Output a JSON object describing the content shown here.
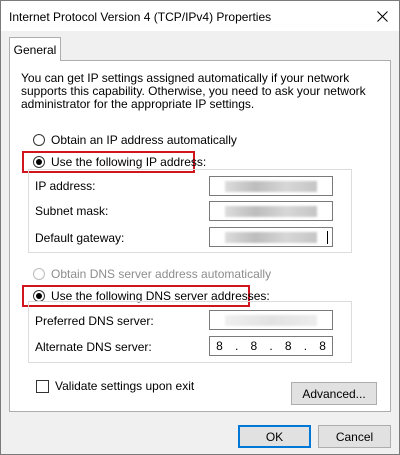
{
  "window": {
    "title": "Internet Protocol Version 4 (TCP/IPv4) Properties"
  },
  "tab": {
    "label": "General"
  },
  "description": "You can get IP settings assigned automatically if your network supports this capability. Otherwise, you need to ask your network administrator for the appropriate IP settings.",
  "ip_mode": {
    "auto_label": "Obtain an IP address automatically",
    "manual_label": "Use the following IP address:",
    "selected": "manual"
  },
  "ip_fields": {
    "ip_address_label": "IP address:",
    "subnet_mask_label": "Subnet mask:",
    "default_gateway_label": "Default gateway:"
  },
  "dns_mode": {
    "auto_label": "Obtain DNS server address automatically",
    "manual_label": "Use the following DNS server addresses:",
    "selected": "manual"
  },
  "dns_fields": {
    "preferred_label": "Preferred DNS server:",
    "alternate_label": "Alternate DNS server:",
    "alternate_octets": [
      "8",
      "8",
      "8",
      "8"
    ],
    "separators": [
      ".",
      ".",
      "."
    ]
  },
  "validate": {
    "label": "Validate settings upon exit",
    "checked": false
  },
  "buttons": {
    "advanced": "Advanced...",
    "ok": "OK",
    "cancel": "Cancel"
  },
  "colors": {
    "highlight": "#d0161c",
    "default_button_border": "#0078d7"
  },
  "icons": {
    "close": "close-icon"
  }
}
